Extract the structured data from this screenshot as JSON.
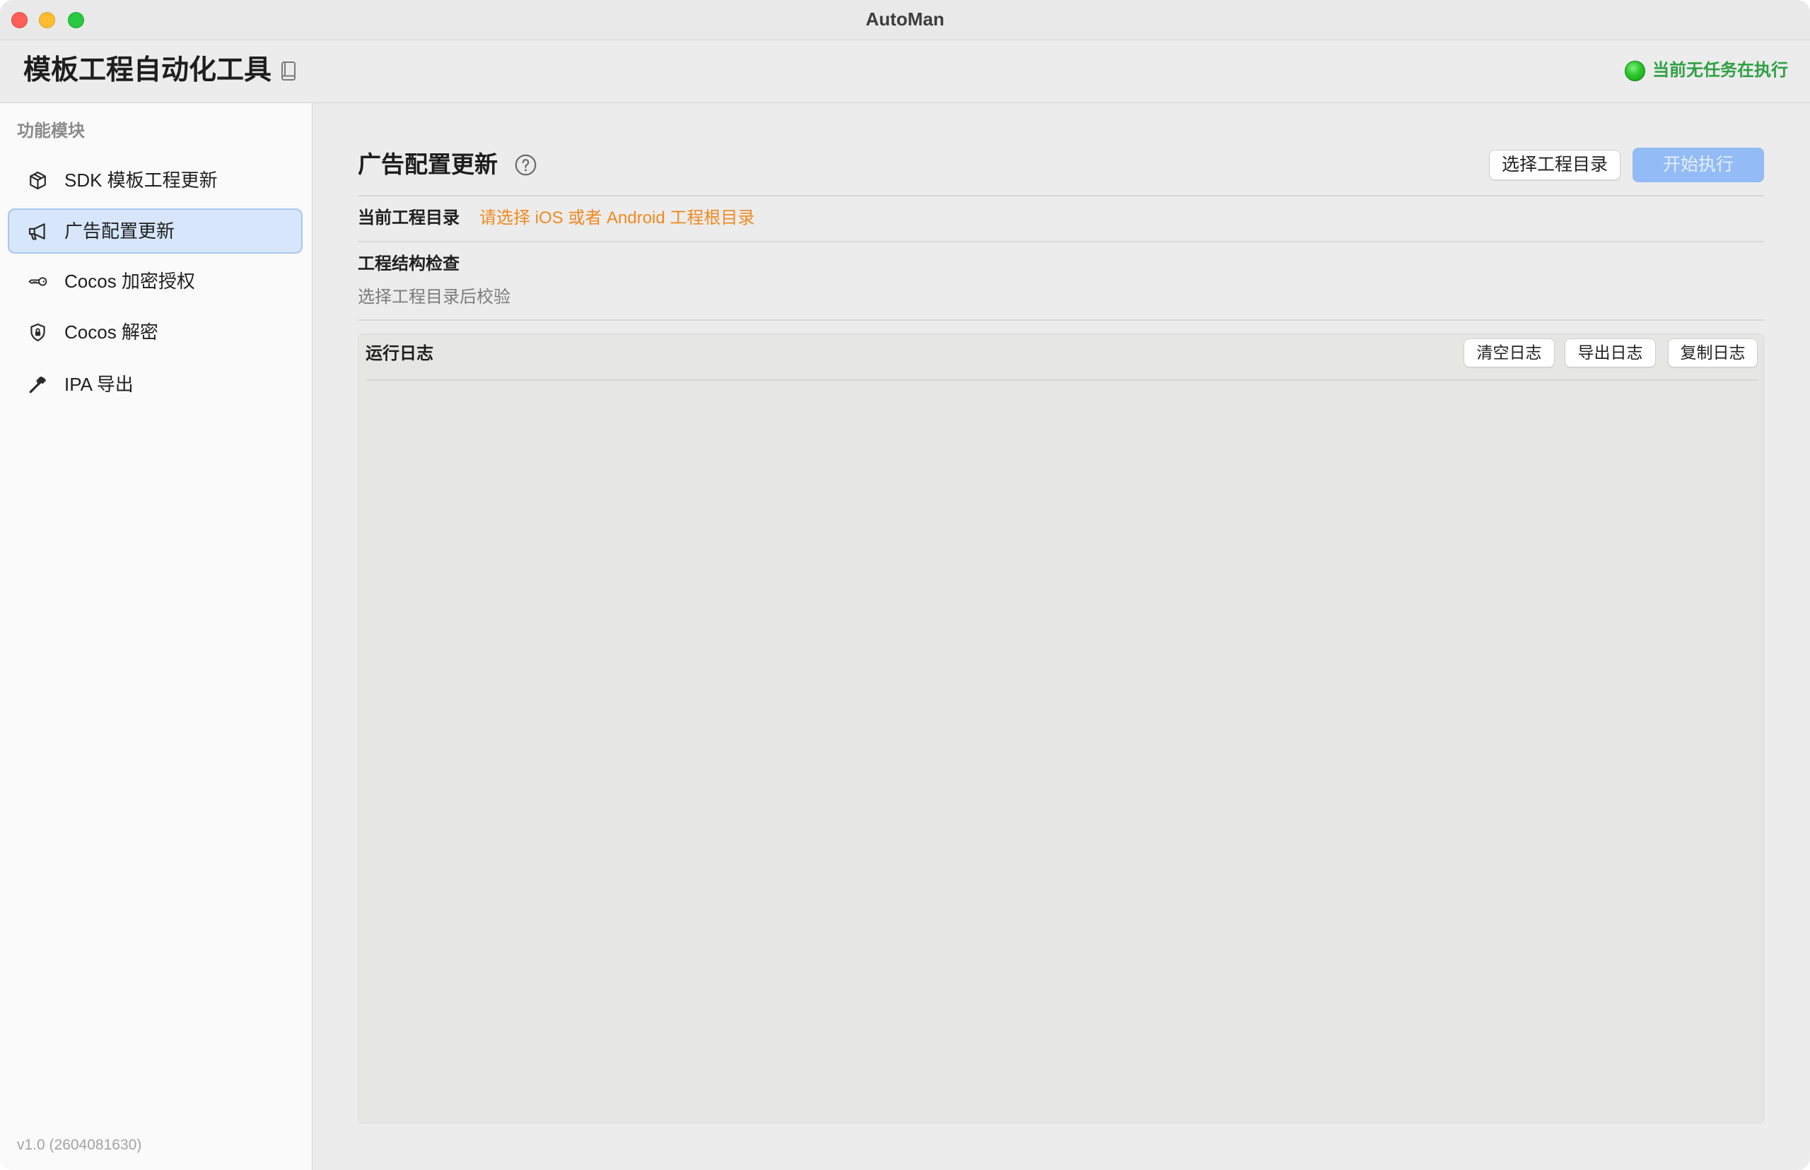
{
  "window": {
    "title": "AutoMan"
  },
  "header": {
    "title": "模板工程自动化工具",
    "status": "当前无任务在执行"
  },
  "sidebar": {
    "section_label": "功能模块",
    "items": [
      {
        "label": "SDK 模板工程更新",
        "icon": "cube-icon",
        "selected": false
      },
      {
        "label": "广告配置更新",
        "icon": "megaphone-icon",
        "selected": true
      },
      {
        "label": "Cocos 加密授权",
        "icon": "key-icon",
        "selected": false
      },
      {
        "label": "Cocos 解密",
        "icon": "lock-shield-icon",
        "selected": false
      },
      {
        "label": "IPA 导出",
        "icon": "hammer-icon",
        "selected": false
      }
    ],
    "version": "v1.0 (2604081630)"
  },
  "main": {
    "title": "广告配置更新",
    "choose_dir_label": "选择工程目录",
    "start_label": "开始执行",
    "start_enabled": false,
    "current_dir_label": "当前工程目录",
    "current_dir_value": "请选择 iOS 或者 Android 工程根目录",
    "structure_check_label": "工程结构检查",
    "structure_check_hint": "选择工程目录后校验",
    "log": {
      "title": "运行日志",
      "clear_label": "清空日志",
      "export_label": "导出日志",
      "copy_label": "复制日志",
      "lines": []
    }
  },
  "colors": {
    "status": "#2ea043",
    "warning": "#f0891f",
    "accent": "#93bbf5",
    "selected_bg": "#d7e6fb",
    "selected_border": "#a8c7f1"
  }
}
